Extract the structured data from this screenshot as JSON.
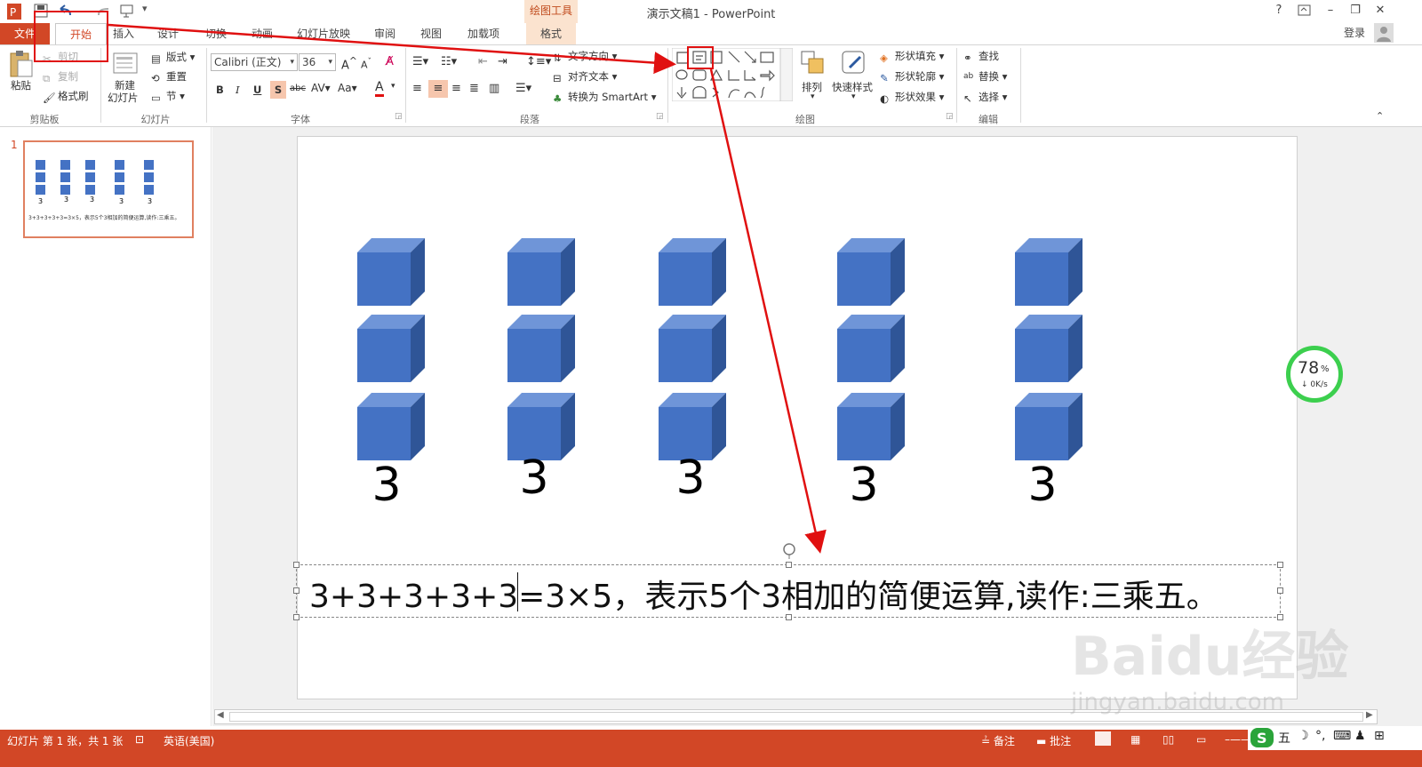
{
  "titlebar": {
    "app_title": "演示文稿1 - PowerPoint",
    "drawing_tools": "绘图工具",
    "login": "登录"
  },
  "tabs": {
    "file": "文件",
    "home": "开始",
    "insert": "插入",
    "design": "设计",
    "transitions": "切换",
    "animations": "动画",
    "slideshow": "幻灯片放映",
    "review": "审阅",
    "view": "视图",
    "addins": "加载项",
    "format": "格式"
  },
  "ribbon": {
    "clipboard": {
      "paste": "粘贴",
      "cut": "剪切",
      "copy": "复制",
      "format_painter": "格式刷",
      "label": "剪贴板"
    },
    "slides": {
      "new_slide": "新建",
      "new_slide2": "幻灯片",
      "layout": "版式",
      "reset": "重置",
      "section": "节",
      "label": "幻灯片"
    },
    "font": {
      "font_name": "Calibri (正文)",
      "font_size": "36",
      "bold": "B",
      "italic": "I",
      "underline": "U",
      "shadow": "S",
      "strike": "abc",
      "spacing": "AV",
      "case": "Aa",
      "color": "A",
      "label": "字体"
    },
    "paragraph": {
      "text_direction": "文字方向",
      "align_text": "对齐文本",
      "smartart": "转换为 SmartArt",
      "label": "段落"
    },
    "drawing": {
      "arrange": "排列",
      "quick_styles": "快速样式",
      "shape_fill": "形状填充",
      "shape_outline": "形状轮廓",
      "shape_effects": "形状效果",
      "label": "绘图"
    },
    "editing": {
      "find": "查找",
      "replace": "替换",
      "select": "选择",
      "label": "编辑"
    }
  },
  "thumbnail": {
    "number": "1",
    "caption": "3+3+3+3+3=3×5，表示5个3相加的简便运算,读作:三乘五。",
    "labels": [
      "3",
      "3",
      "3",
      "3",
      "3"
    ]
  },
  "slide": {
    "column_numbers": [
      "3",
      "3",
      "3",
      "3",
      "3"
    ],
    "equation_text": "3+3+3+3+3=3×5，表示5个3相加的简便运算,读作:三乘五。"
  },
  "statusbar": {
    "slide_info": "幻灯片 第 1 张，共 1 张",
    "language": "英语(美国)",
    "notes": "备注",
    "comments": "批注",
    "ime": "五"
  },
  "speed_widget": {
    "percent": "78",
    "percent_unit": "%",
    "rate": "0K/s"
  },
  "watermark": {
    "brand": "Baidu经验",
    "url": "jingyan.baidu.com"
  },
  "colors": {
    "accent": "#d24726",
    "cube": "#4472c4",
    "highlight_box": "#e01010",
    "speed_ring": "#3ccf4e"
  }
}
